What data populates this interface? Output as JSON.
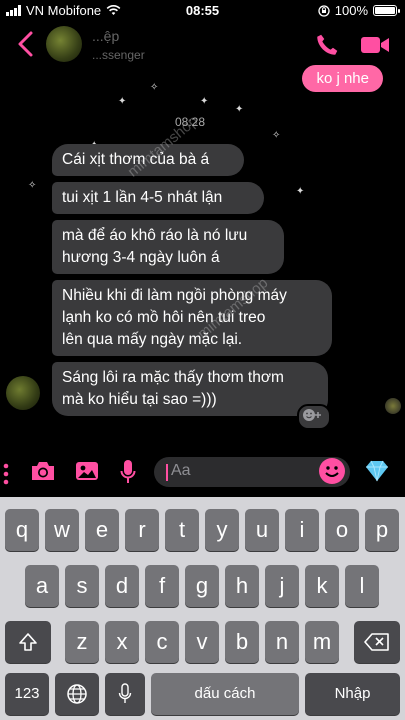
{
  "status": {
    "carrier": "VN Mobifone",
    "time": "08:55",
    "battery": "100%",
    "battery_level": 1.0
  },
  "header": {
    "name": "...ệp",
    "subtitle": "...ssenger"
  },
  "messages": {
    "sent": "ko j nhe",
    "timestamp": "08:28",
    "received": [
      "Cái xịt thơm của bà á",
      "tui xịt 1 lần 4-5 nhát lận",
      "mà để áo khô ráo là nó lưu\nhương 3-4 ngày luôn á",
      "Nhiều khi đi làm ngồi phòng máy\nlạnh ko có mồ hôi nên tui treo\nlên qua mấy ngày mặc lại.",
      "Sáng lôi ra mặc thấy thơm thơm\nmà ko hiểu tại sao =)))"
    ],
    "watermark": "mimtamshop"
  },
  "composer": {
    "placeholder": "Aa"
  },
  "keyboard": {
    "row1": [
      "q",
      "w",
      "e",
      "r",
      "t",
      "y",
      "u",
      "i",
      "o",
      "p"
    ],
    "row2": [
      "a",
      "s",
      "d",
      "f",
      "g",
      "h",
      "j",
      "k",
      "l"
    ],
    "row3": [
      "z",
      "x",
      "c",
      "v",
      "b",
      "n",
      "m"
    ],
    "numbers": "123",
    "space": "dấu cách",
    "return": "Nhập"
  },
  "colors": {
    "accent": "#ff4fa2",
    "bubble_sent": "#ff68a6",
    "bubble_received": "#3a3a3c"
  }
}
